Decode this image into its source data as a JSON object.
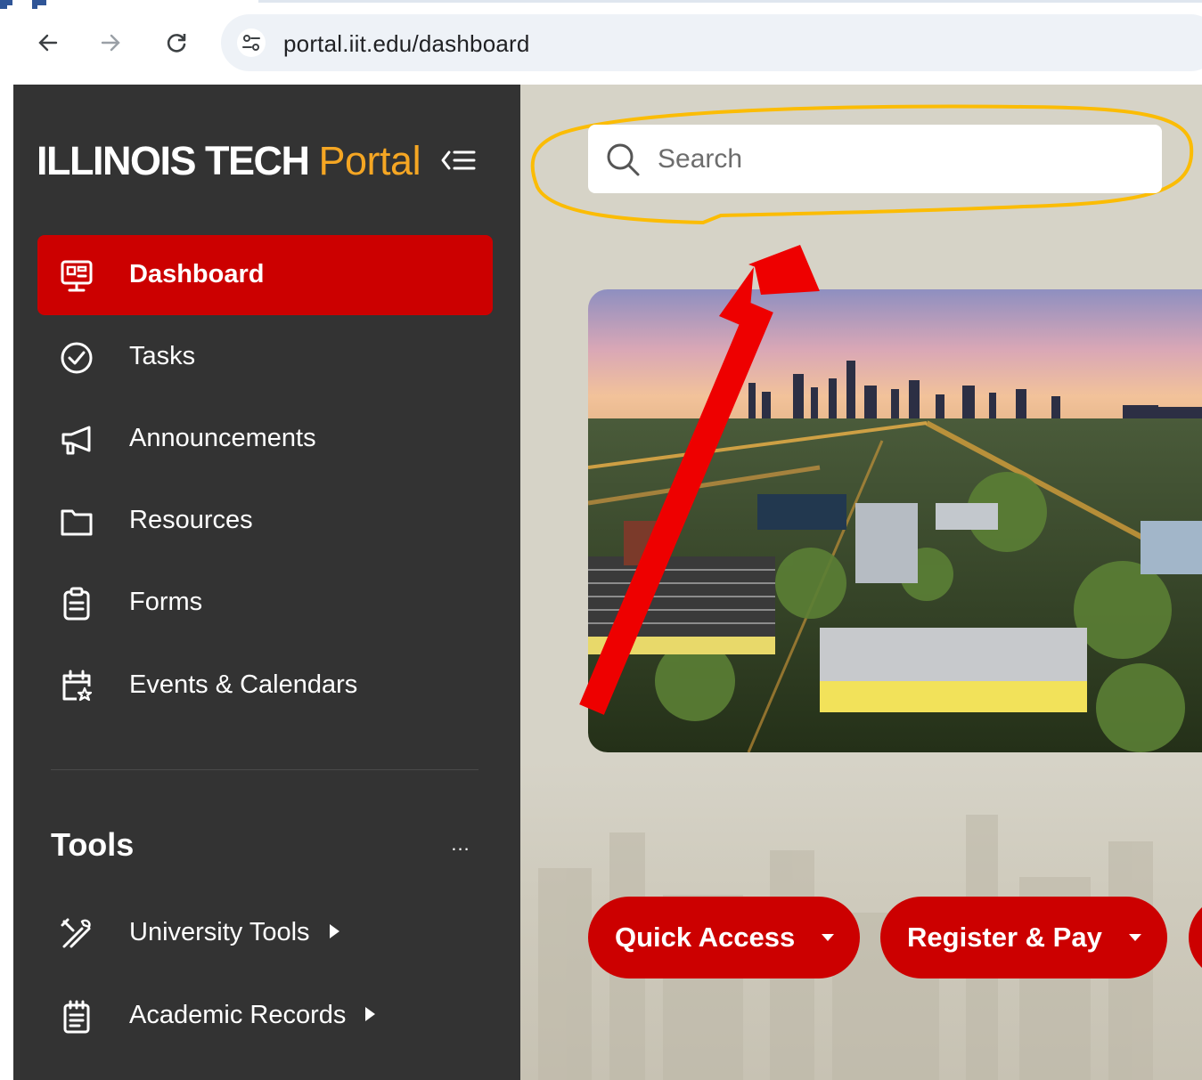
{
  "browser": {
    "url": "portal.iit.edu/dashboard",
    "back_icon": "arrow-left-icon",
    "forward_icon": "arrow-right-icon",
    "reload_icon": "reload-icon",
    "site_info_icon": "tune-icon"
  },
  "sidebar": {
    "brand_main": "ILLINOIS TECH",
    "brand_portal": "Portal",
    "brand_color": "#f5a623",
    "active_color": "#cc0000",
    "items": [
      {
        "label": "Dashboard",
        "icon": "dashboard-monitor-icon",
        "active": true
      },
      {
        "label": "Tasks",
        "icon": "check-circle-icon"
      },
      {
        "label": "Announcements",
        "icon": "megaphone-icon"
      },
      {
        "label": "Resources",
        "icon": "folder-icon"
      },
      {
        "label": "Forms",
        "icon": "clipboard-icon"
      },
      {
        "label": "Events & Calendars",
        "icon": "calendar-star-icon"
      }
    ],
    "tools_title": "Tools",
    "tools_more": "...",
    "tools": [
      {
        "label": "University Tools",
        "icon": "tools-icon"
      },
      {
        "label": "Academic Records",
        "icon": "notepad-icon"
      }
    ]
  },
  "main": {
    "search": {
      "placeholder": "Search"
    },
    "quick_buttons": [
      {
        "label": "Quick Access"
      },
      {
        "label": "Register & Pay"
      }
    ]
  }
}
